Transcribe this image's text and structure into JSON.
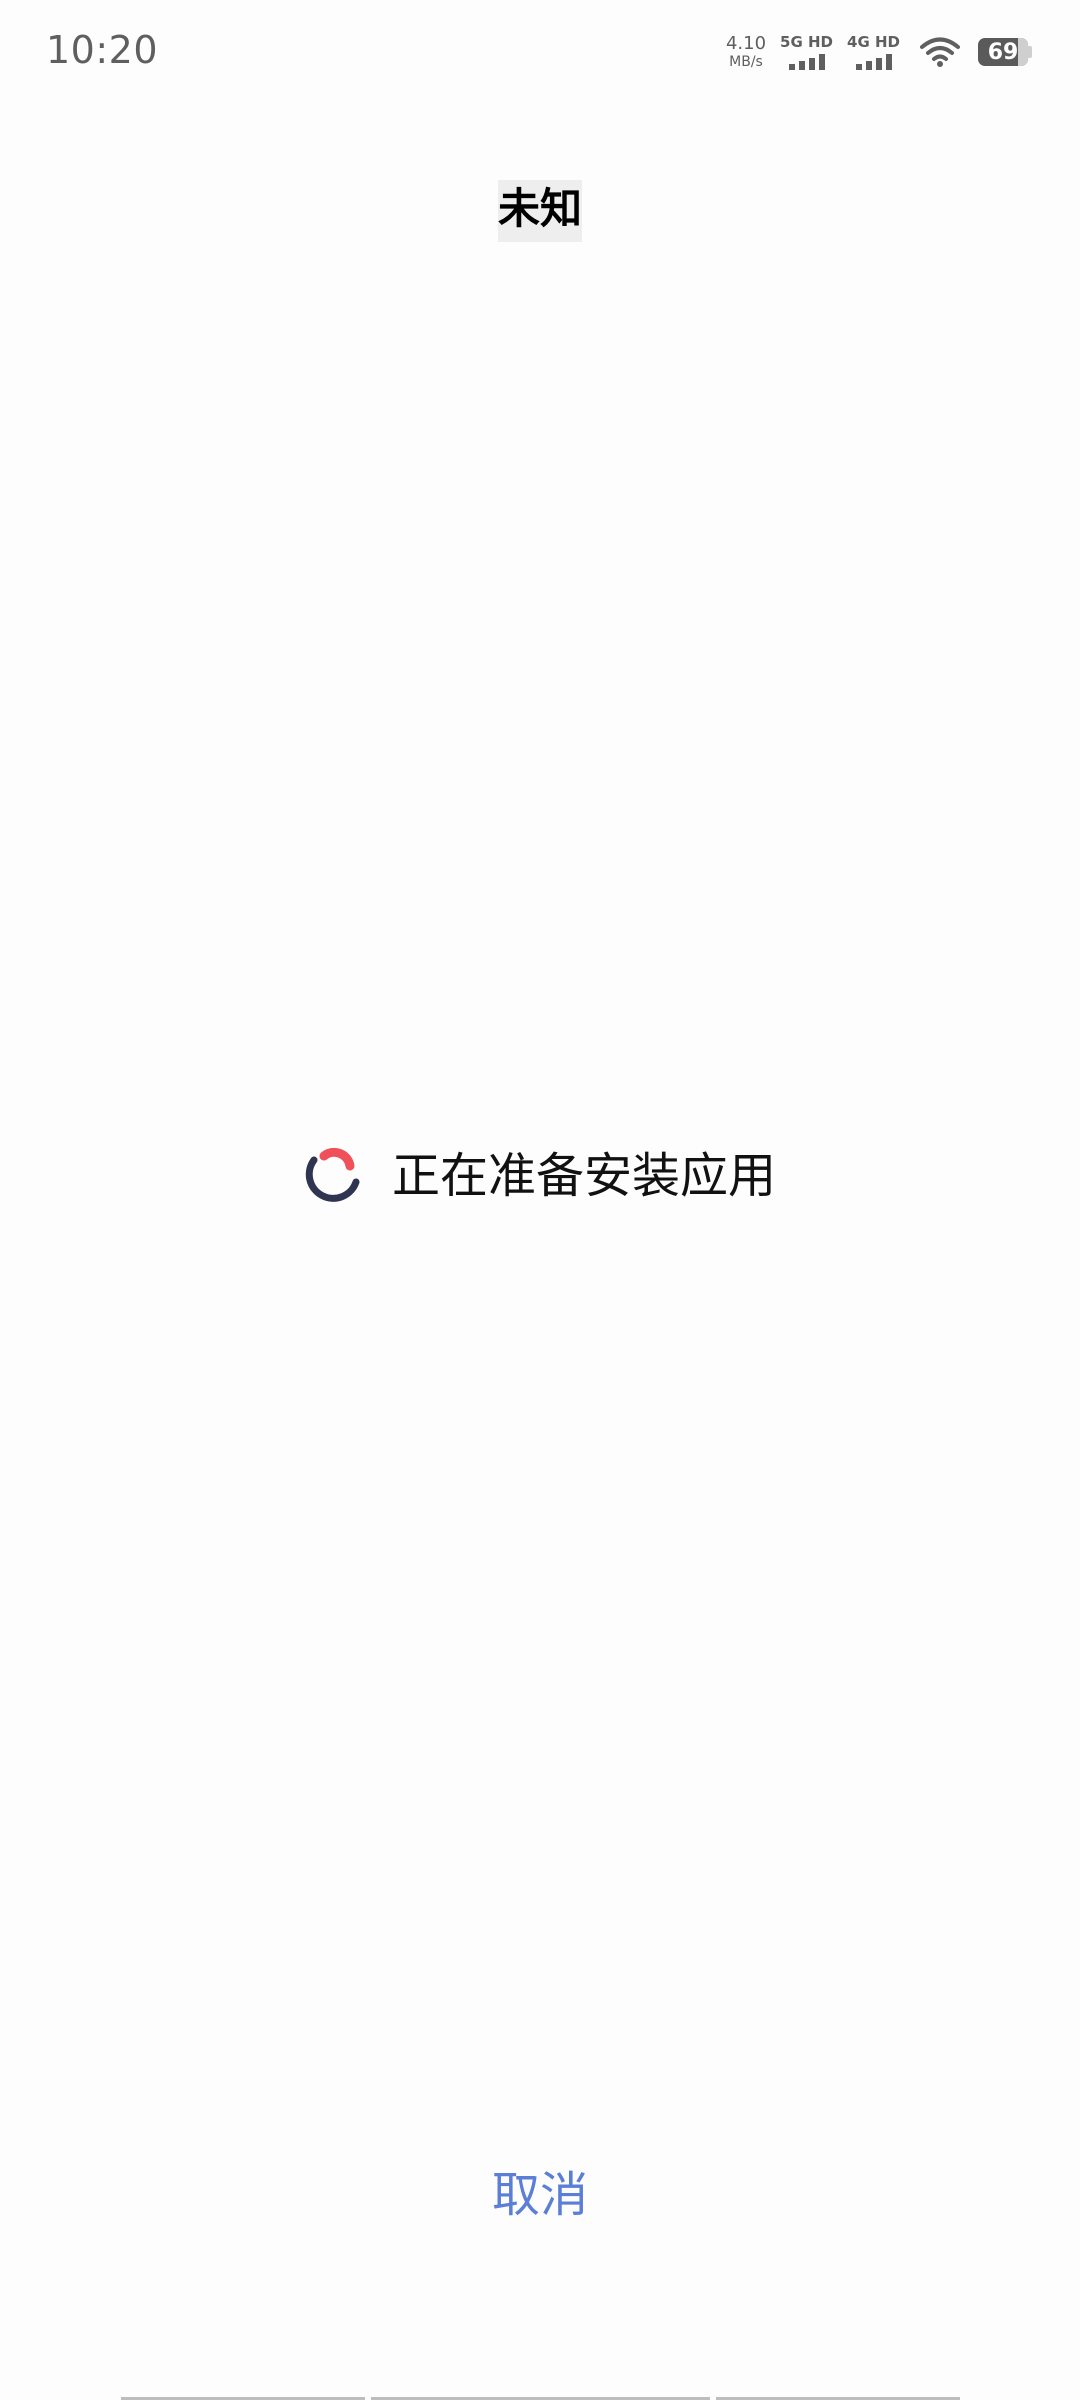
{
  "status_bar": {
    "time": "10:20",
    "net_speed_value": "4.10",
    "net_speed_unit": "MB/s",
    "sim1_label": "5G HD",
    "sim2_label": "4G HD",
    "battery_level": "69"
  },
  "header": {
    "title": "未知"
  },
  "progress": {
    "message": "正在准备安装应用"
  },
  "actions": {
    "cancel_label": "取消"
  },
  "colors": {
    "accent": "#5b7fd6",
    "spinner_dark": "#2f3550",
    "spinner_red": "#f0505a"
  }
}
